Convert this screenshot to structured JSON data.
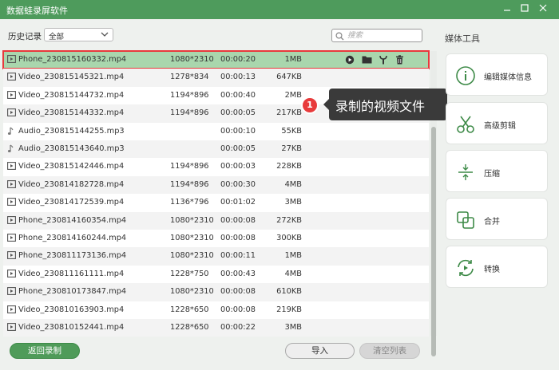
{
  "window": {
    "title": "数据蛙录屏软件",
    "controls": [
      "min-icon",
      "restore-icon",
      "close-icon"
    ]
  },
  "filter": {
    "label": "历史记录",
    "selected": "全部"
  },
  "search": {
    "placeholder": "搜索"
  },
  "files": [
    {
      "name": "Phone_230815160332.mp4",
      "resolution": "1080*2310",
      "duration": "00:00:20",
      "size": "1MB",
      "type": "video",
      "selected": true
    },
    {
      "name": "Video_230815145321.mp4",
      "resolution": "1278*834",
      "duration": "00:00:13",
      "size": "647KB",
      "type": "video"
    },
    {
      "name": "Video_230815144732.mp4",
      "resolution": "1194*896",
      "duration": "00:00:40",
      "size": "2MB",
      "type": "video"
    },
    {
      "name": "Video_230815144332.mp4",
      "resolution": "1194*896",
      "duration": "00:00:05",
      "size": "217KB",
      "type": "video"
    },
    {
      "name": "Audio_230815144255.mp3",
      "resolution": "",
      "duration": "00:00:10",
      "size": "55KB",
      "type": "audio"
    },
    {
      "name": "Audio_230815143640.mp3",
      "resolution": "",
      "duration": "00:00:05",
      "size": "27KB",
      "type": "audio"
    },
    {
      "name": "Video_230815142446.mp4",
      "resolution": "1194*896",
      "duration": "00:00:03",
      "size": "228KB",
      "type": "video"
    },
    {
      "name": "Video_230814182728.mp4",
      "resolution": "1194*896",
      "duration": "00:00:30",
      "size": "4MB",
      "type": "video"
    },
    {
      "name": "Video_230814172539.mp4",
      "resolution": "1136*796",
      "duration": "00:01:02",
      "size": "3MB",
      "type": "video"
    },
    {
      "name": "Phone_230814160354.mp4",
      "resolution": "1080*2310",
      "duration": "00:00:08",
      "size": "272KB",
      "type": "video"
    },
    {
      "name": "Phone_230814160244.mp4",
      "resolution": "1080*2310",
      "duration": "00:00:08",
      "size": "300KB",
      "type": "video"
    },
    {
      "name": "Phone_230811173136.mp4",
      "resolution": "1080*2310",
      "duration": "00:00:11",
      "size": "1MB",
      "type": "video"
    },
    {
      "name": "Video_230811161111.mp4",
      "resolution": "1228*750",
      "duration": "00:00:43",
      "size": "4MB",
      "type": "video"
    },
    {
      "name": "Phone_230810173847.mp4",
      "resolution": "1080*2310",
      "duration": "00:00:08",
      "size": "610KB",
      "type": "video"
    },
    {
      "name": "Video_230810163903.mp4",
      "resolution": "1228*650",
      "duration": "00:00:08",
      "size": "219KB",
      "type": "video"
    },
    {
      "name": "Video_230810152441.mp4",
      "resolution": "1228*650",
      "duration": "00:00:22",
      "size": "3MB",
      "type": "video"
    }
  ],
  "row_actions": [
    "play-icon",
    "folder-icon",
    "edit-tool-icon",
    "trash-icon"
  ],
  "tooltip": {
    "badge": "1",
    "text": "录制的视频文件"
  },
  "tools": {
    "title": "媒体工具",
    "items": [
      {
        "label": "编辑媒体信息",
        "icon": "info-icon"
      },
      {
        "label": "高级剪辑",
        "icon": "scissors-icon"
      },
      {
        "label": "压缩",
        "icon": "compress-icon"
      },
      {
        "label": "合并",
        "icon": "merge-icon"
      },
      {
        "label": "转换",
        "icon": "convert-icon"
      }
    ]
  },
  "buttons": {
    "back": "返回录制",
    "import": "导入",
    "clear": "清空列表"
  },
  "colors": {
    "accent": "#4e9b5c",
    "selected_row": "#a9d6ad",
    "highlight_border": "#e8393c"
  }
}
